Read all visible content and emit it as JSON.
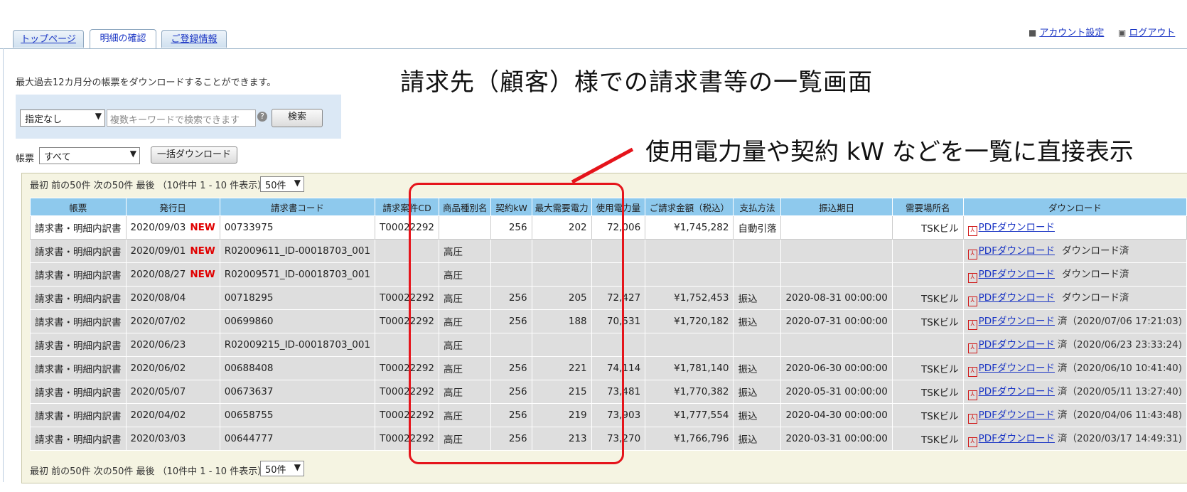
{
  "tabs": [
    {
      "label": "トップページ"
    },
    {
      "label": "明細の確認"
    },
    {
      "label": "ご登録情報"
    }
  ],
  "account": {
    "settings": "アカウント設定",
    "logout": "ログアウト"
  },
  "notice": "最大過去12カ月分の帳票をダウンロードすることができます。",
  "annotation_title": "請求先（顧客）様での請求書等の一覧画面",
  "annotation_note": "使用電力量や契約 kW などを一覧に直接表示",
  "search": {
    "filter_selected": "指定なし",
    "placeholder": "複数キーワードで検索できます",
    "help": "?",
    "button": "検索"
  },
  "doc_filter": {
    "label": "帳票",
    "selected": "すべて",
    "bulk_button": "一括ダウンロード"
  },
  "pager": {
    "text": "最初 前の50件 次の50件 最後 （10件中 1 - 10 件表示）",
    "per_page": "50件"
  },
  "table": {
    "columns": [
      "帳票",
      "発行日",
      "請求書コード",
      "請求案件CD",
      "商品種別名",
      "契約kW",
      "最大需要電力",
      "使用電力量",
      "ご請求金額（税込）",
      "支払方法",
      "振込期日",
      "需要場所名",
      "ダウンロード"
    ],
    "new_badge": "NEW",
    "pdf_link": "PDFダウンロード",
    "rows": [
      {
        "doc": "請求書・明細内訳書",
        "date": "2020/09/03",
        "new": true,
        "code": "00733975",
        "case": "T00022292",
        "kind": "",
        "kw": "256",
        "peak": "202",
        "usage": "72,006",
        "amount": "¥1,745,282",
        "pay": "自動引落",
        "due": "",
        "place": "TSKビル",
        "status": ""
      },
      {
        "doc": "請求書・明細内訳書",
        "date": "2020/09/01",
        "new": true,
        "code": "R02009611_ID-00018703_001",
        "case": "",
        "kind": "高圧",
        "kw": "",
        "peak": "",
        "usage": "",
        "amount": "",
        "pay": "",
        "due": "",
        "place": "",
        "status": "ダウンロード済"
      },
      {
        "doc": "請求書・明細内訳書",
        "date": "2020/08/27",
        "new": true,
        "code": "R02009571_ID-00018703_001",
        "case": "",
        "kind": "高圧",
        "kw": "",
        "peak": "",
        "usage": "",
        "amount": "",
        "pay": "",
        "due": "",
        "place": "",
        "status": "ダウンロード済"
      },
      {
        "doc": "請求書・明細内訳書",
        "date": "2020/08/04",
        "new": false,
        "code": "00718295",
        "case": "T00022292",
        "kind": "高圧",
        "kw": "256",
        "peak": "205",
        "usage": "72,427",
        "amount": "¥1,752,453",
        "pay": "振込",
        "due": "2020-08-31 00:00:00",
        "place": "TSKビル",
        "status": "ダウンロード済"
      },
      {
        "doc": "請求書・明細内訳書",
        "date": "2020/07/02",
        "new": false,
        "code": "00699860",
        "case": "T00022292",
        "kind": "高圧",
        "kw": "256",
        "peak": "188",
        "usage": "70,531",
        "amount": "¥1,720,182",
        "pay": "振込",
        "due": "2020-07-31 00:00:00",
        "place": "TSKビル",
        "status": "済（2020/07/06 17:21:03)"
      },
      {
        "doc": "請求書・明細内訳書",
        "date": "2020/06/23",
        "new": false,
        "code": "R02009215_ID-00018703_001",
        "case": "",
        "kind": "高圧",
        "kw": "",
        "peak": "",
        "usage": "",
        "amount": "",
        "pay": "",
        "due": "",
        "place": "",
        "status": "済（2020/06/23 23:33:24)"
      },
      {
        "doc": "請求書・明細内訳書",
        "date": "2020/06/02",
        "new": false,
        "code": "00688408",
        "case": "T00022292",
        "kind": "高圧",
        "kw": "256",
        "peak": "221",
        "usage": "74,114",
        "amount": "¥1,781,140",
        "pay": "振込",
        "due": "2020-06-30 00:00:00",
        "place": "TSKビル",
        "status": "済（2020/06/10 10:41:40)"
      },
      {
        "doc": "請求書・明細内訳書",
        "date": "2020/05/07",
        "new": false,
        "code": "00673637",
        "case": "T00022292",
        "kind": "高圧",
        "kw": "256",
        "peak": "215",
        "usage": "73,481",
        "amount": "¥1,770,382",
        "pay": "振込",
        "due": "2020-05-31 00:00:00",
        "place": "TSKビル",
        "status": "済（2020/05/11 13:27:40)"
      },
      {
        "doc": "請求書・明細内訳書",
        "date": "2020/04/02",
        "new": false,
        "code": "00658755",
        "case": "T00022292",
        "kind": "高圧",
        "kw": "256",
        "peak": "219",
        "usage": "73,903",
        "amount": "¥1,777,554",
        "pay": "振込",
        "due": "2020-04-30 00:00:00",
        "place": "TSKビル",
        "status": "済（2020/04/06 11:43:48)"
      },
      {
        "doc": "請求書・明細内訳書",
        "date": "2020/03/03",
        "new": false,
        "code": "00644777",
        "case": "T00022292",
        "kind": "高圧",
        "kw": "256",
        "peak": "213",
        "usage": "73,270",
        "amount": "¥1,766,796",
        "pay": "振込",
        "due": "2020-03-31 00:00:00",
        "place": "TSKビル",
        "status": "済（2020/03/17 14:49:31)"
      }
    ]
  },
  "colors": {
    "accent_red": "#e5141b",
    "header_blue": "#8ec9ed",
    "link": "#1a35c4"
  }
}
